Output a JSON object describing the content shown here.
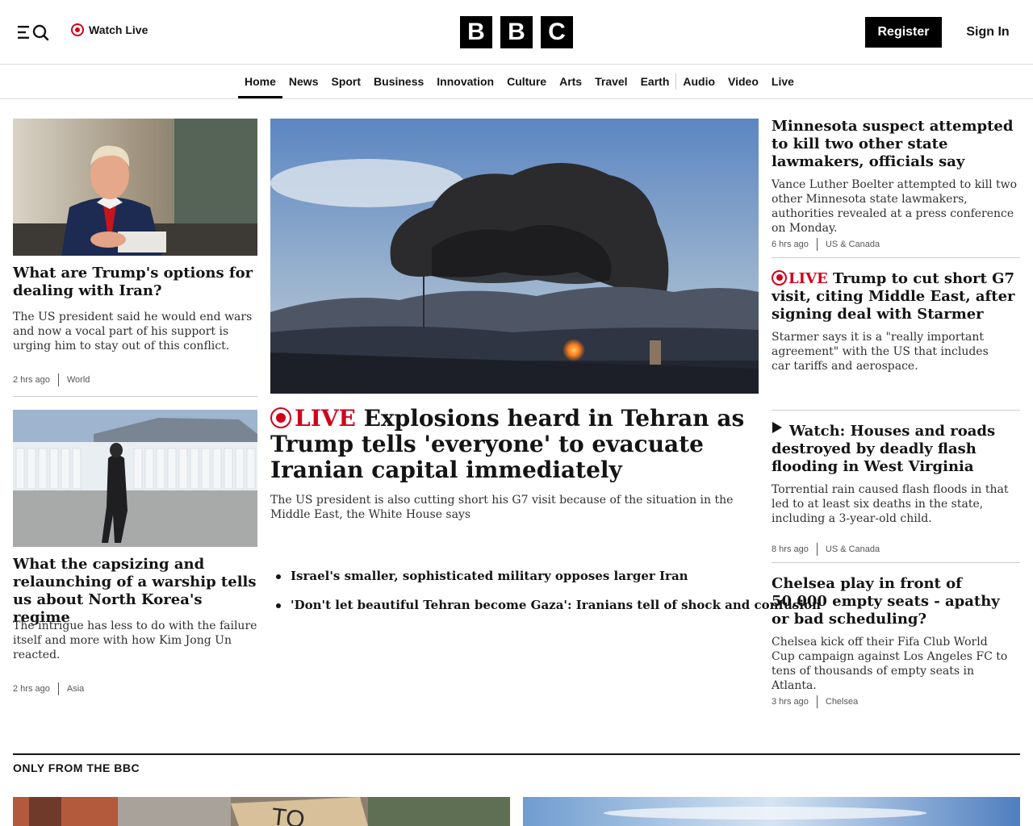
{
  "header": {
    "watch_live": "Watch Live",
    "logo_letters": [
      "B",
      "B",
      "C"
    ],
    "register": "Register",
    "sign_in": "Sign In"
  },
  "nav": {
    "items": [
      "Home",
      "News",
      "Sport",
      "Business",
      "Innovation",
      "Culture",
      "Arts",
      "Travel",
      "Earth",
      "Audio",
      "Video",
      "Live"
    ],
    "active": "Home"
  },
  "left": {
    "story1": {
      "title": "What are Trump's options for dealing with Iran?",
      "summary": "The US president said he would end wars and now a vocal part of his support is urging him to stay out of this conflict.",
      "time": "2 hrs ago",
      "category": "World"
    },
    "story2": {
      "title": "What the capsizing and relaunching of a warship tells us about North Korea's regime",
      "summary": "The intrigue has less to do with the failure itself and more with how Kim Jong Un reacted.",
      "time": "2 hrs ago",
      "category": "Asia"
    }
  },
  "main": {
    "live_label": "LIVE",
    "title": "Explosions heard in Tehran as Trump tells 'everyone' to evacuate Iranian capital immediately",
    "summary": "The US president is also cutting short his G7 visit because of the situation in the Middle East, the White House says",
    "related": [
      "Israel's smaller, sophisticated military opposes larger Iran",
      "'Don't let beautiful Tehran become Gaza': Iranians tell of shock and confusion"
    ]
  },
  "right": {
    "story1": {
      "title": "Minnesota suspect attempted to kill two other state lawmakers, officials say",
      "summary": "Vance Luther Boelter attempted to kill two other Minnesota state lawmakers, authorities revealed at a press conference on Monday.",
      "time": "6 hrs ago",
      "category": "US & Canada"
    },
    "story2": {
      "live_label": "LIVE",
      "title": "Trump to cut short G7 visit, citing Middle East, after signing deal with Starmer",
      "summary": "Starmer says it is a \"really important agreement\" with the US that includes car tariffs and aerospace."
    },
    "story3": {
      "title": "Watch: Houses and roads destroyed by deadly flash flooding in West Virginia",
      "summary": "Torrential rain caused flash floods in that led to at least six deaths in the state, including a 3-year-old child.",
      "time": "8 hrs ago",
      "category": "US & Canada"
    },
    "story4": {
      "title": "Chelsea play in front of 50,000 empty seats - apathy or bad scheduling?",
      "summary": "Chelsea kick off their Fifa Club World Cup campaign against Los Angeles FC to tens of thousands of empty seats in Atlanta.",
      "time": "3 hrs ago",
      "category": "Chelsea"
    }
  },
  "section": {
    "title": "ONLY FROM THE BBC",
    "sign_text": "TO"
  },
  "colors": {
    "live_red": "#d0021b",
    "text": "#141414",
    "brand_black": "#000000"
  }
}
